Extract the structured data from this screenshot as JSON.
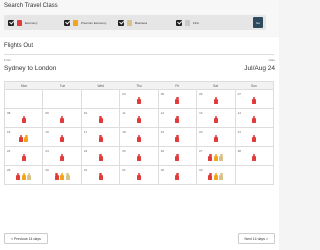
{
  "search": {
    "title": "Search Travel Class",
    "classes": [
      {
        "label": "Economy",
        "color": "#e23b3b",
        "checked": true
      },
      {
        "label": "Premium Economy",
        "color": "#f2a51c",
        "checked": true
      },
      {
        "label": "Business",
        "color": "#d6c28b",
        "checked": true
      },
      {
        "label": "First",
        "color": "#c9c9c9",
        "checked": true
      }
    ],
    "go_label": "Go"
  },
  "flights": {
    "title": "Flights Out",
    "from_label": "From",
    "route": "Sydney to London",
    "date_label": "Date",
    "month": "Jul/Aug 24"
  },
  "calendar": {
    "days": [
      "Mon",
      "Tue",
      "Wed",
      "Thu",
      "Fri",
      "Sat",
      "Sun"
    ],
    "weeks": [
      [
        null,
        null,
        null,
        {
          "n": "04",
          "s": [
            "e"
          ]
        },
        {
          "n": "05",
          "s": [
            "e"
          ]
        },
        {
          "n": "06",
          "s": [
            "e"
          ]
        },
        {
          "n": "07",
          "s": [
            "e"
          ]
        }
      ],
      [
        {
          "n": "08",
          "s": [
            "e"
          ]
        },
        {
          "n": "09",
          "s": [
            "e"
          ]
        },
        {
          "n": "10",
          "s": [
            "e"
          ]
        },
        {
          "n": "11",
          "s": [
            "e"
          ]
        },
        {
          "n": "12",
          "s": [
            "e"
          ]
        },
        {
          "n": "13",
          "s": [
            "e"
          ]
        },
        {
          "n": "14",
          "s": [
            "e"
          ]
        }
      ],
      [
        {
          "n": "15",
          "s": [
            "e",
            "p"
          ]
        },
        {
          "n": "16",
          "s": [
            "e"
          ]
        },
        {
          "n": "17",
          "s": [
            "e"
          ]
        },
        {
          "n": "18",
          "s": [
            "e"
          ]
        },
        {
          "n": "19",
          "s": [
            "e"
          ]
        },
        {
          "n": "20",
          "s": [
            "e"
          ]
        },
        {
          "n": "21",
          "s": [
            "e"
          ]
        }
      ],
      [
        {
          "n": "22",
          "s": [
            "e"
          ]
        },
        {
          "n": "23",
          "s": [
            "e"
          ]
        },
        {
          "n": "24",
          "s": [
            "e"
          ]
        },
        {
          "n": "25",
          "s": [
            "e"
          ]
        },
        {
          "n": "26",
          "s": [
            "e"
          ]
        },
        {
          "n": "27",
          "s": [
            "e",
            "p",
            "b"
          ]
        },
        {
          "n": "28",
          "s": [
            "e"
          ]
        }
      ],
      [
        {
          "n": "29",
          "s": [
            "e",
            "p",
            "b"
          ]
        },
        {
          "n": "30",
          "s": [
            "e",
            "p",
            "b"
          ]
        },
        {
          "n": "31",
          "s": [
            "e"
          ]
        },
        {
          "n": "01",
          "s": [
            "e"
          ]
        },
        {
          "n": "02",
          "s": [
            "e"
          ]
        },
        {
          "n": "03",
          "s": [
            "e",
            "p",
            "b"
          ]
        },
        null
      ]
    ],
    "seat_colors": {
      "e": "#e23b3b",
      "p": "#f2a51c",
      "b": "#d6c28b"
    }
  },
  "nav": {
    "prev_label": "< Previous 14 days",
    "next_label": "Next 14 days >"
  }
}
